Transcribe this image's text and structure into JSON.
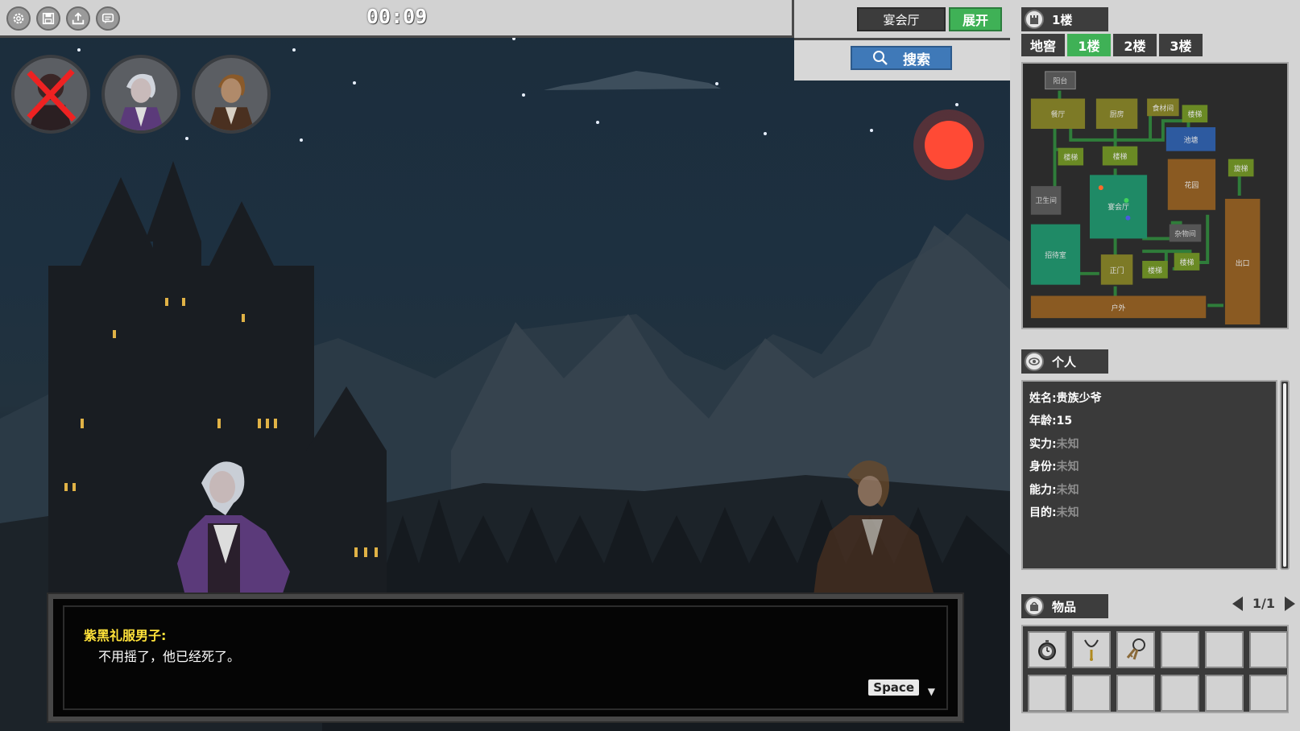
{
  "topbar": {
    "timer": "00:09",
    "icons": [
      "gear-icon",
      "save-icon",
      "upload-icon",
      "chat-icon"
    ]
  },
  "location": {
    "current_room": "宴会厅",
    "expand_label": "展开",
    "search_label": "搜索"
  },
  "portraits": [
    {
      "name": "dead-man-portrait",
      "dead": true
    },
    {
      "name": "purple-suit-man-portrait",
      "dead": false
    },
    {
      "name": "brown-coat-man-portrait",
      "dead": false
    }
  ],
  "dialog": {
    "speaker": "紫黑礼服男子:",
    "text": "不用摇了，他已经死了。",
    "continue_key": "Space"
  },
  "map_panel": {
    "title": "1楼",
    "tabs": [
      {
        "label": "地窖",
        "active": false
      },
      {
        "label": "1楼",
        "active": true
      },
      {
        "label": "2楼",
        "active": false
      },
      {
        "label": "3楼",
        "active": false
      }
    ],
    "rooms": {
      "terrace": "阳台",
      "dining": "餐厅",
      "kitchen": "厨房",
      "storage": "食材间",
      "stairs": "楼梯",
      "pond": "池塘",
      "spiral": "旋梯",
      "restroom": "卫生间",
      "banquet": "宴会厅",
      "garden": "花园",
      "utility": "杂物间",
      "reception": "招待室",
      "main_gate": "正门",
      "exit": "出口",
      "outdoor": "户外"
    },
    "colors": {
      "olive": "#7d7a26",
      "teal": "#1f8a66",
      "blue": "#2d5aa0",
      "brown": "#8a5a22",
      "gray": "#555555"
    }
  },
  "personal": {
    "title": "个人",
    "fields": [
      {
        "label": "姓名:",
        "value": "贵族少爷",
        "known": true
      },
      {
        "label": "年龄:",
        "value": "15",
        "known": true
      },
      {
        "label": "实力:",
        "value": "未知",
        "known": false
      },
      {
        "label": "身份:",
        "value": "未知",
        "known": false
      },
      {
        "label": "能力:",
        "value": "未知",
        "known": false
      },
      {
        "label": "目的:",
        "value": "未知",
        "known": false
      }
    ]
  },
  "items": {
    "title": "物品",
    "page": "1/1",
    "slots": [
      "pocket-watch-icon",
      "necklace-icon",
      "keys-icon",
      "",
      "",
      "",
      "",
      "",
      "",
      "",
      "",
      ""
    ]
  }
}
